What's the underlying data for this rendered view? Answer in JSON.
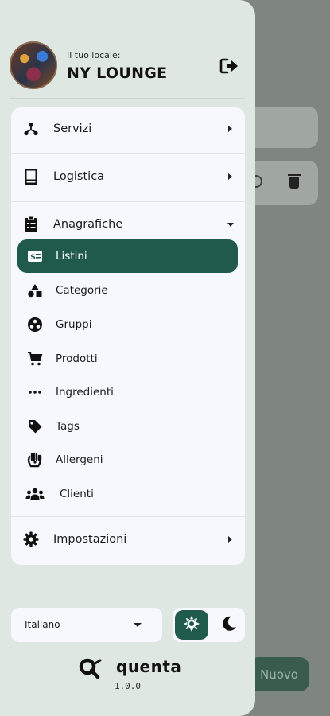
{
  "background": {
    "new_button_label": "Nuovo"
  },
  "header": {
    "local_label": "Il tuo locale:",
    "local_name": "NY LOUNGE"
  },
  "menu": {
    "servizi": "Servizi",
    "logistica": "Logistica",
    "anagrafiche": "Anagrafiche",
    "impostazioni": "Impostazioni",
    "submenu": [
      {
        "label": "Listini",
        "icon": "price-list-icon",
        "active": true
      },
      {
        "label": "Categorie",
        "icon": "shapes-icon"
      },
      {
        "label": "Gruppi",
        "icon": "group-circle-icon"
      },
      {
        "label": "Prodotti",
        "icon": "cart-icon"
      },
      {
        "label": "Ingredienti",
        "icon": "dots-icon"
      },
      {
        "label": "Tags",
        "icon": "tag-icon"
      },
      {
        "label": "Allergeni",
        "icon": "hand-icon"
      },
      {
        "label": "Clienti",
        "icon": "users-icon"
      }
    ]
  },
  "footer": {
    "language": "Italiano",
    "brand": "quenta",
    "version": "1.0.0"
  },
  "colors": {
    "accent": "#1f5a4c",
    "drawer_bg": "#dfe7e3",
    "panel_bg": "#f7f8fd"
  }
}
